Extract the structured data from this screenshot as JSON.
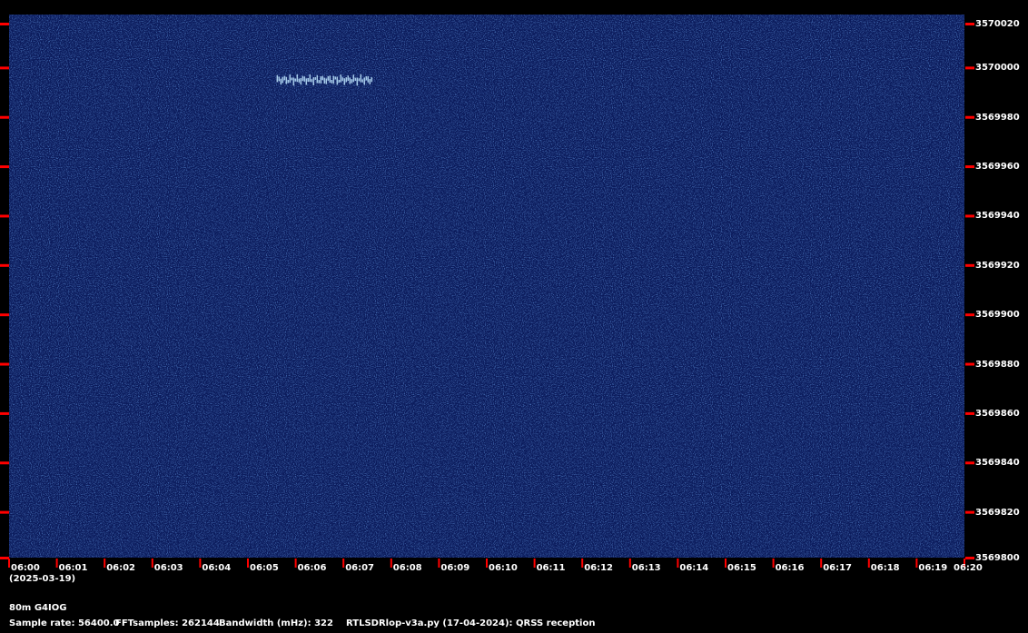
{
  "chart_data": {
    "type": "heatmap",
    "title": "",
    "x_tick_labels": [
      "06:00",
      "06:01",
      "06:02",
      "06:03",
      "06:04",
      "06:05",
      "06:06",
      "06:07",
      "06:08",
      "06:09",
      "06:10",
      "06:11",
      "06:12",
      "06:13",
      "06:14",
      "06:15",
      "06:16",
      "06:17",
      "06:18",
      "06:19",
      "06:20"
    ],
    "x_date_label": "(2025-03-19)",
    "xlim": [
      "06:00",
      "06:20"
    ],
    "y_tick_labels": [
      "3570020",
      "3570000",
      "3569980",
      "3569960",
      "3569940",
      "3569920",
      "3569900",
      "3569880",
      "3569860",
      "3569840",
      "3569820",
      "3569800"
    ],
    "ylim": [
      3569800,
      3570020
    ],
    "signals": [
      {
        "start": "06:05.6",
        "end": "06:07.6",
        "frequency": 3569995
      }
    ],
    "colors": {
      "background": "#0b1b5c",
      "noise_light": "#3a78c8",
      "tick": "#ff0000",
      "signal": "#bfe6ff"
    }
  },
  "footer": {
    "station": "80m G4IOG",
    "sample_rate": "Sample rate: 56400.0",
    "fft_samples": "FFTsamples: 262144",
    "bandwidth": "Bandwidth (mHz): 322",
    "software": "RTLSDRlop-v3a.py (17-04-2024): QRSS reception"
  }
}
